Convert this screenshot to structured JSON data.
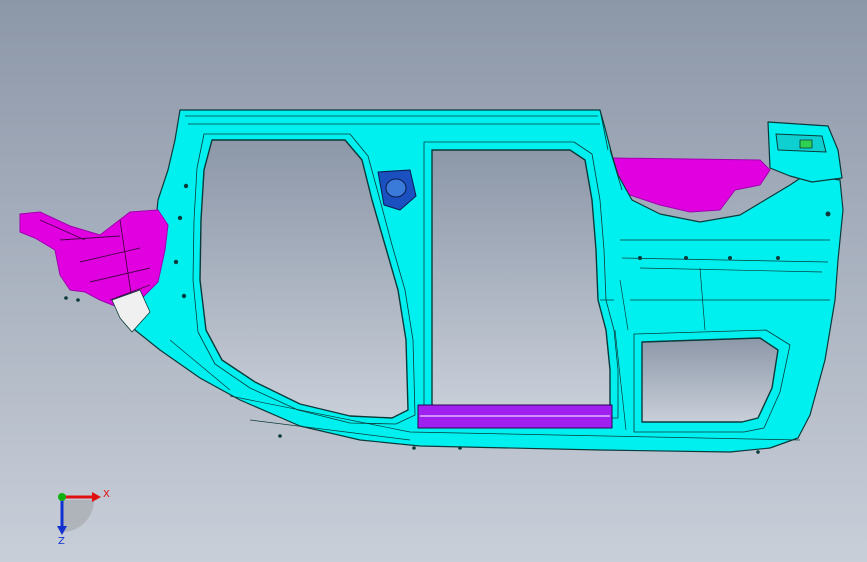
{
  "viewport": {
    "background_top": "#8c97a8",
    "background_bottom": "#c9cfd9"
  },
  "model": {
    "colors": {
      "body": "#00f0f0",
      "body_edge": "#0a3a3a",
      "accent": "#e000e0",
      "accent_dark": "#a000b0",
      "sill": "#a020f0",
      "fitting": "#1a50c0",
      "white_part": "#f0f0f0"
    }
  },
  "triad": {
    "x_label": "X",
    "z_label": "Z",
    "x_color": "#e01010",
    "y_color": "#10b010",
    "z_color": "#1030d0",
    "origin_color": "#8a8a8a"
  }
}
